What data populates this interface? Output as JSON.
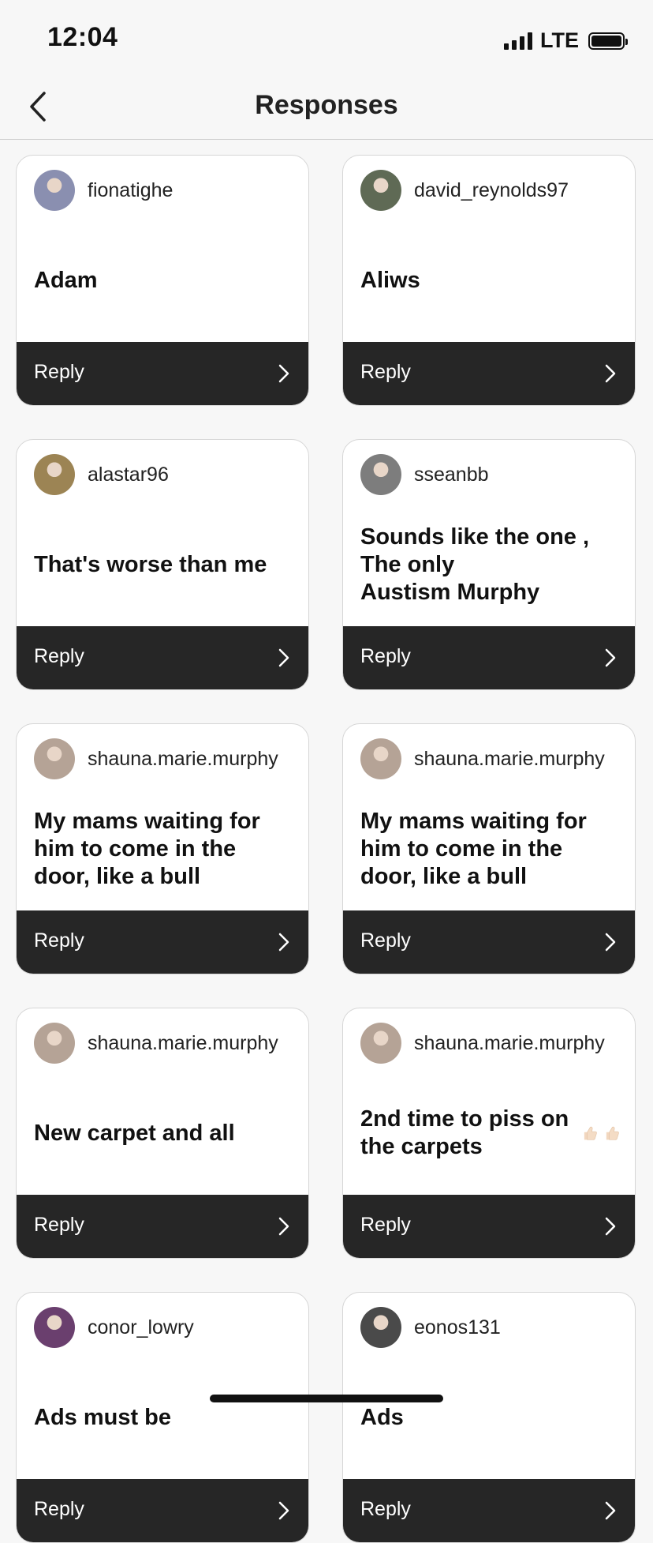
{
  "status": {
    "time": "12:04",
    "network": "LTE"
  },
  "nav": {
    "title": "Responses"
  },
  "cards": [
    {
      "username": "fionatighe",
      "message": "Adam",
      "reply": "Reply",
      "avatar_color": "#8a8fb0"
    },
    {
      "username": "david_reynolds97",
      "message": "Aliws",
      "reply": "Reply",
      "avatar_color": "#5f6a55"
    },
    {
      "username": "alastar96",
      "message": "That's worse than me",
      "reply": "Reply",
      "avatar_color": "#9c8454"
    },
    {
      "username": "sseanbb",
      "message": "Sounds like the one ,\nThe only\nAustism Murphy",
      "reply": "Reply",
      "avatar_color": "#7d7d7d"
    },
    {
      "username": "shauna.marie.murphy",
      "message": "My mams waiting for him to come in the door, like a bull",
      "reply": "Reply",
      "avatar_color": "#b5a396"
    },
    {
      "username": "shauna.marie.murphy",
      "message": "My mams waiting for him to come in the door, like a bull",
      "reply": "Reply",
      "avatar_color": "#b5a396"
    },
    {
      "username": "shauna.marie.murphy",
      "message": "New carpet and all",
      "reply": "Reply",
      "avatar_color": "#b5a396"
    },
    {
      "username": "shauna.marie.murphy",
      "message": "2nd time to piss on the carpets",
      "message_emoji": "thumbs-up-light-skin x2",
      "reply": "Reply",
      "avatar_color": "#b5a396"
    },
    {
      "username": "conor_lowry",
      "message": "Ads must be",
      "reply": "Reply",
      "avatar_color": "#6a3f6e"
    },
    {
      "username": "eonos131",
      "message": "Ads",
      "reply": "Reply",
      "avatar_color": "#4a4a4a"
    }
  ],
  "colors": {
    "background": "#f7f7f7",
    "card": "#ffffff",
    "reply_bar": "#262626",
    "text": "#111111"
  },
  "icons": {
    "back": "chevron-left-icon",
    "reply": "chevron-right-icon",
    "emoji": "thumbs-up-icon"
  }
}
